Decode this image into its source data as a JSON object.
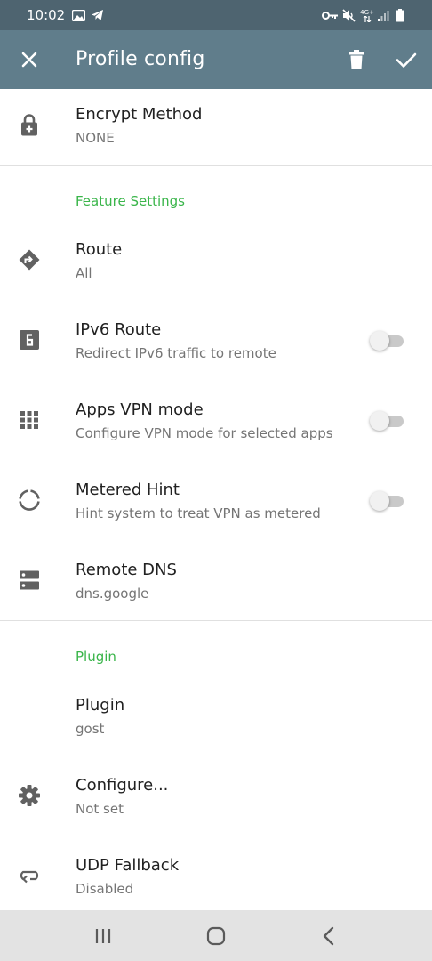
{
  "status_bar": {
    "time": "10:02",
    "icons": [
      "gallery-icon",
      "telegram-icon",
      "vpn-key-icon",
      "mute-icon",
      "network-4g-icon",
      "signal-icon",
      "battery-icon"
    ],
    "network_label": "4G+"
  },
  "toolbar": {
    "title": "Profile config",
    "close_icon": "close-icon",
    "delete_icon": "delete-icon",
    "save_icon": "check-icon"
  },
  "items": {
    "encrypt_method": {
      "title": "Encrypt Method",
      "summary": "NONE",
      "icon": "lock-icon"
    },
    "route": {
      "title": "Route",
      "summary": "All",
      "icon": "directions-icon"
    },
    "ipv6_route": {
      "title": "IPv6 Route",
      "summary": "Redirect IPv6 traffic to remote",
      "icon": "ipv6-icon",
      "checked": false
    },
    "apps_vpn_mode": {
      "title": "Apps VPN mode",
      "summary": "Configure VPN mode for selected apps",
      "icon": "apps-grid-icon",
      "checked": false
    },
    "metered_hint": {
      "title": "Metered Hint",
      "summary": "Hint system to treat VPN as metered",
      "icon": "data-usage-icon",
      "checked": false
    },
    "remote_dns": {
      "title": "Remote DNS",
      "summary": "dns.google",
      "icon": "dns-icon"
    },
    "plugin": {
      "title": "Plugin",
      "summary": "gost"
    },
    "configure": {
      "title": "Configure...",
      "summary": "Not set",
      "icon": "settings-icon"
    },
    "udp_fallback": {
      "title": "UDP Fallback",
      "summary": "Disabled",
      "icon": "fallback-icon"
    }
  },
  "sections": {
    "feature_settings": "Feature Settings",
    "plugin": "Plugin"
  },
  "navbar": {
    "recents_icon": "recents-icon",
    "home_icon": "home-icon",
    "back_icon": "back-icon"
  },
  "colors": {
    "toolbar": "#607d8b",
    "status_bar": "#4e6470",
    "accent": "#3ab54a",
    "icon": "#616161"
  }
}
